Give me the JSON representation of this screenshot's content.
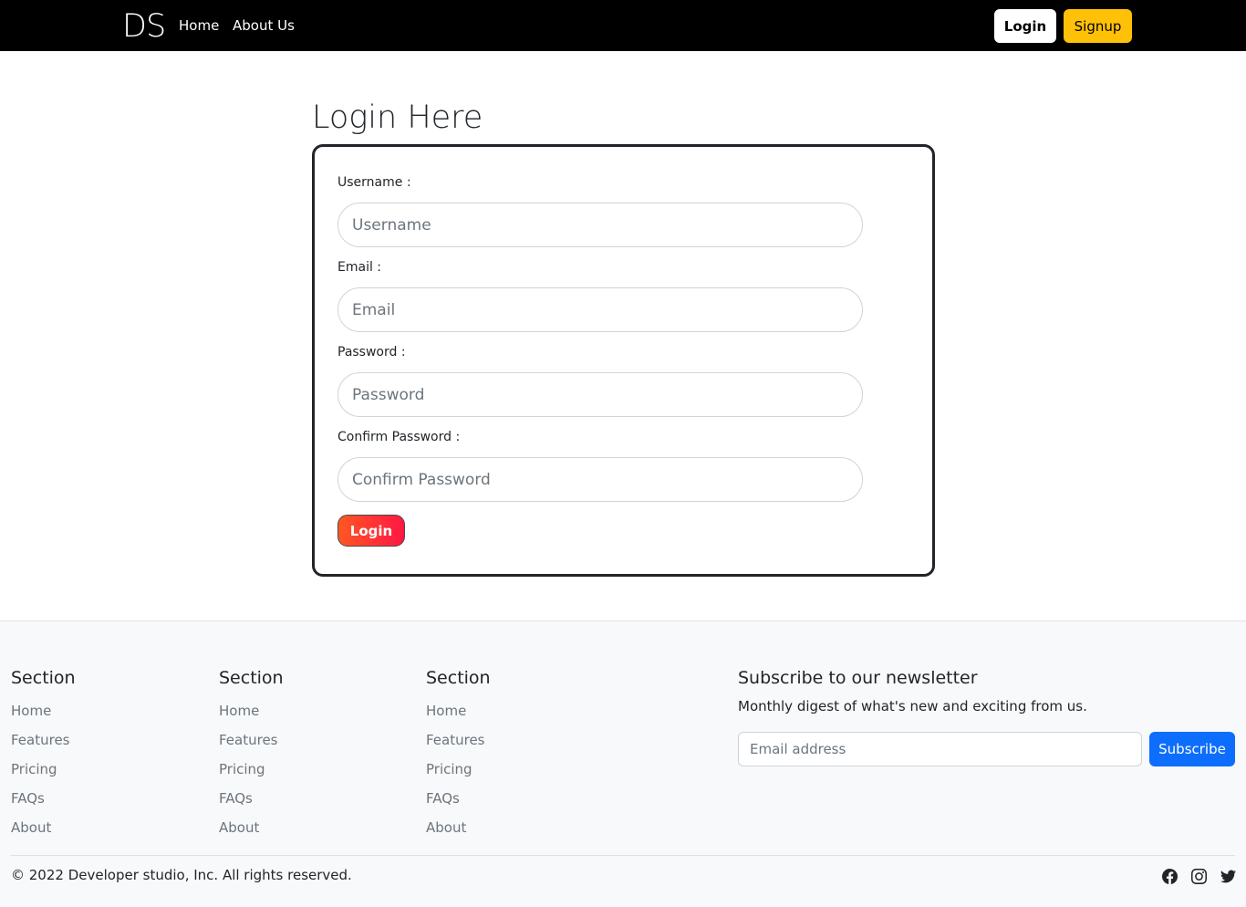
{
  "navbar": {
    "brand": "DS",
    "links": [
      "Home",
      "About Us"
    ],
    "login_label": "Login",
    "signup_label": "Signup"
  },
  "main": {
    "title": "Login Here",
    "fields": [
      {
        "label": "Username :",
        "placeholder": "Username"
      },
      {
        "label": "Email :",
        "placeholder": "Email"
      },
      {
        "label": "Password :",
        "placeholder": "Password"
      },
      {
        "label": "Confirm Password :",
        "placeholder": "Confirm Password"
      }
    ],
    "submit_label": "Login"
  },
  "footer": {
    "columns": [
      {
        "heading": "Section",
        "links": [
          "Home",
          "Features",
          "Pricing",
          "FAQs",
          "About"
        ]
      },
      {
        "heading": "Section",
        "links": [
          "Home",
          "Features",
          "Pricing",
          "FAQs",
          "About"
        ]
      },
      {
        "heading": "Section",
        "links": [
          "Home",
          "Features",
          "Pricing",
          "FAQs",
          "About"
        ]
      }
    ],
    "newsletter": {
      "heading": "Subscribe to our newsletter",
      "description": "Monthly digest of what's new and exciting from us.",
      "placeholder": "Email address",
      "button_label": "Subscribe"
    },
    "copyright": "© 2022 Developer studio, Inc. All rights reserved.",
    "social_icons": [
      "facebook-icon",
      "instagram-icon",
      "twitter-icon"
    ]
  },
  "colors": {
    "navbar_bg": "#000000",
    "signup_bg": "#ffc107",
    "subscribe_bg": "#0d6efd",
    "submit_gradient_start": "#ff5722",
    "submit_gradient_end": "#ff1744"
  }
}
